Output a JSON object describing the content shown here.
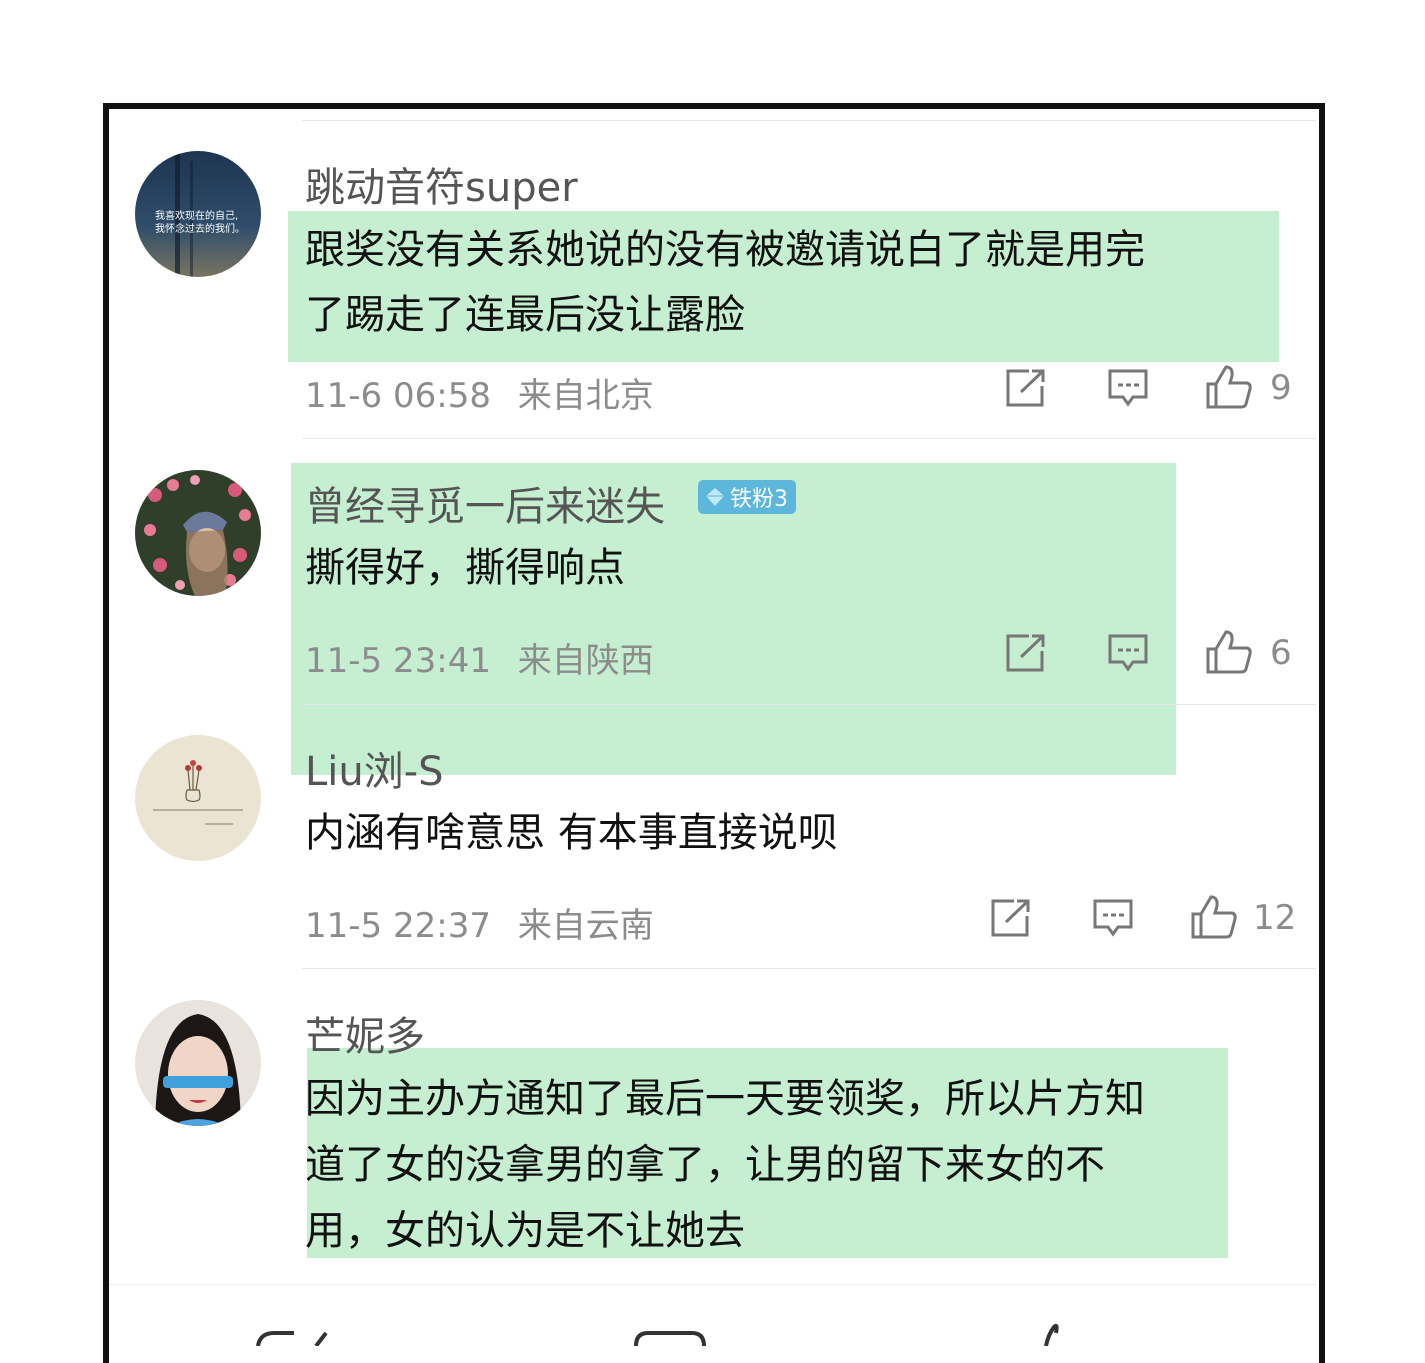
{
  "comments": [
    {
      "username": "跳动音符super",
      "text_lines": [
        "跟奖没有关系她说的没有被邀请说白了就是用完",
        "了踢走了连最后没让露脸"
      ],
      "time": "11-6 06:58",
      "location": "来自北京",
      "likes": "9",
      "avatar_caption": [
        "我喜欢现在的自己,",
        "我怀念过去的我们。"
      ]
    },
    {
      "username": "曾经寻觅一后来迷失",
      "badge": "铁粉3",
      "text_lines": [
        "撕得好，撕得响点"
      ],
      "time": "11-5 23:41",
      "location": "来自陕西",
      "likes": "6"
    },
    {
      "username": "Liu浏-S",
      "text_lines": [
        "内涵有啥意思 有本事直接说呗"
      ],
      "time": "11-5 22:37",
      "location": "来自云南",
      "likes": "12"
    },
    {
      "username": "芒妮多",
      "text_lines": [
        "因为主办方通知了最后一天要领奖，所以片方知",
        "道了女的没拿男的拿了，让男的留下来女的不",
        "用，女的认为是不让她去"
      ]
    }
  ],
  "colors": {
    "highlight": "#c6efd1",
    "badge": "#5db7da",
    "meta_text": "#8c8c8c"
  },
  "icons": [
    "share-icon",
    "comment-icon",
    "like-icon",
    "diamond-icon"
  ]
}
